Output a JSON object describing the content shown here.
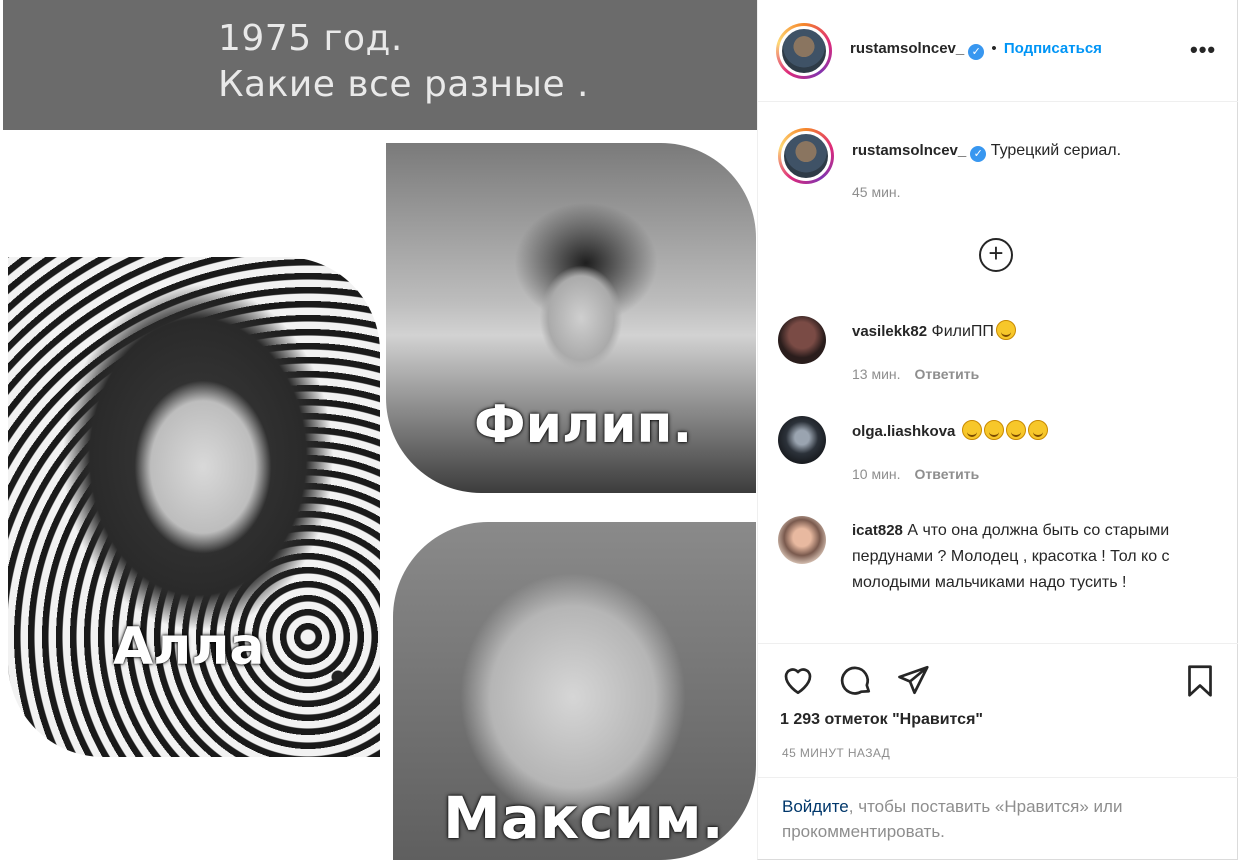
{
  "media": {
    "banner_line_1": "1975 год.",
    "banner_line_2": "Какие все разные .",
    "captions": {
      "alla": "Алла",
      "filip": "Филип.",
      "maxim": "Максим."
    }
  },
  "header": {
    "username": "rustamsolncev_",
    "separator": "•",
    "follow_label": "Подписаться",
    "more_icon": "more-horizontal-icon"
  },
  "caption_comment": {
    "username": "rustamsolncev_",
    "text": "Турецкий сериал.",
    "time": "45 мин."
  },
  "load_more_icon": "plus-circle-icon",
  "comments": [
    {
      "username": "vasilekk82",
      "text": "ФилиПП",
      "emoji_count": 1,
      "time": "13 мин.",
      "reply": "Ответить"
    },
    {
      "username": "olga.liashkova",
      "text": "",
      "emoji_count": 4,
      "time": "10 мин.",
      "reply": "Ответить"
    },
    {
      "username": "icat828",
      "text": "А что она должна быть со старыми пердунами ? Молодец , красотка ! Тол ко с молодыми мальчиками надо тусить !"
    }
  ],
  "actions": {
    "icons": [
      "heart-icon",
      "comment-icon",
      "share-icon",
      "bookmark-icon"
    ],
    "likes": "1 293 отметок \"Нравится\"",
    "time": "45 МИНУТ НАЗАД"
  },
  "login_prompt": {
    "link": "Войдите",
    "text": ", чтобы поставить «Нравится» или прокомментировать."
  },
  "colors": {
    "accent": "#0095f6",
    "verified": "#3897f0",
    "muted": "#8e8e8e"
  }
}
